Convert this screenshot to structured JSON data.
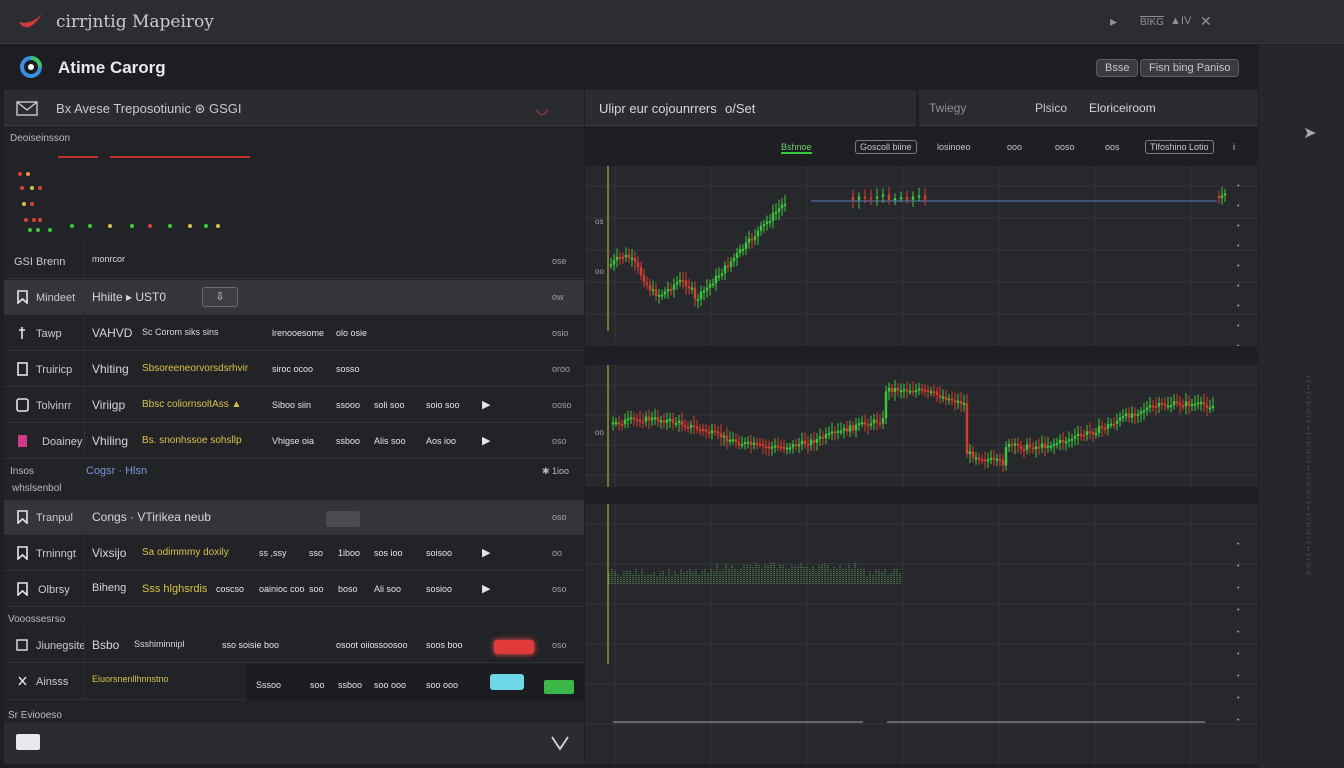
{
  "window": {
    "title": "cirrjntig Mapeiroy",
    "controls": [
      "▸",
      "BIKG",
      "▲IV",
      "✕"
    ]
  },
  "header": {
    "app_name": "Atime Carorg",
    "pill_left": "Bsse",
    "pill_right": "Fisn bing Paniso"
  },
  "left": {
    "header_text": "Bx Avese Treposotiunic ⊛ GSGI",
    "description_label": "Deoiseinsson",
    "rows_top": [
      {
        "name": "GSI Brenn",
        "c1": "monrcor",
        "right": "ose"
      },
      {
        "name": "Mindeet",
        "c1": "Hhiite ▸ UST0",
        "right": "ow"
      },
      {
        "name": "Tawp",
        "c1": "VAHVD",
        "c2": "Sc Corom siks   sins",
        "n1": "lrenooesome",
        "n2": "olo osie",
        "right": "osio"
      },
      {
        "name": "Truiricp",
        "c1": "Vhiting",
        "c2": "Sbsoreeneorvorsdsrhvir",
        "n1": "siroc ocoo",
        "n2": "sosso",
        "right": "oroo"
      },
      {
        "name": "Tolvinrr",
        "c1": "Viriigp",
        "c2": "Bbsc coliornsoltAss ▲",
        "n1": "Siboo  siin",
        "n2": "ssooo",
        "n3": "soli soo",
        "n4": "soio soo",
        "right": "ooso"
      },
      {
        "name": "Doainey",
        "c1": "Vhiling",
        "c2": "Bs. snonhssoe sohsllp",
        "n1": "Vhigse  oia",
        "n2": "ssboo",
        "n3": "Alis soo",
        "n4": "Aos ioo",
        "right": "oso"
      }
    ],
    "mid_label_left": "Insos",
    "mid_label_link": "Cogsr · Hlsn",
    "mid_label_right": "✱ 1ioo",
    "mid_label_sub": "whslsenbol",
    "rows_bottom": [
      {
        "name": "Tranpul",
        "c1": "Congs ·  VTirikea neub",
        "right": "oso"
      },
      {
        "name": "Trninngt",
        "c1": "Vixsijo",
        "c2": "Sa odimmmy doxily",
        "n1": "ss ,ssy",
        "n2": "sso",
        "n3": "1iboo",
        "n4": "sos ioo",
        "n5": "soisoo",
        "right": "oo"
      },
      {
        "name": "Olbrsy",
        "c1": "Biheng",
        "c2": "Sss hlghsrdis",
        "c3": "coscso",
        "n1": "oainioc coo",
        "n2": "soo",
        "n3": "boso",
        "n4": "Ali soo",
        "n5": "sosioo",
        "right": "oso"
      }
    ],
    "section2_label": "Vooossesrso",
    "rows_extra": [
      {
        "name": "Jiunegsite",
        "c1": "Bsbo",
        "c2": "Ssshiminnipl",
        "n1": "sso soisie boo",
        "n2": "osoot oiio",
        "n3": "ssoosoo",
        "n4": "soos boo",
        "right": "oso"
      },
      {
        "name": "Ainsss",
        "c1": "Eiuorsnenllhnnstno",
        "n1": "Sssoo",
        "n2": "soo",
        "n3": "ssboo",
        "n4": "soo ooo",
        "n5": "soo ooo"
      }
    ],
    "footer_label": "Sr Eviooeso"
  },
  "chart": {
    "title_left": "Ulipr eur cojounrrers",
    "title_left_suffix": "o/Set",
    "title_right_a": "Twiegy",
    "title_right_b": "Plsico",
    "title_right_c": "Eloriceiroom",
    "tabs": [
      "Bshnoe",
      "Goscoll biine",
      "losinoeo",
      "ooo",
      "ooso",
      "oos",
      "Tlfoshino Lotio",
      "i"
    ],
    "colors": {
      "up": "#3cc83c",
      "down": "#d83a2e",
      "flat": "#5a78c8"
    }
  },
  "icons": {
    "window": "app-logo-icon",
    "mail": "mail-icon",
    "send": "send-icon",
    "chevron": "chevron-down-icon"
  }
}
